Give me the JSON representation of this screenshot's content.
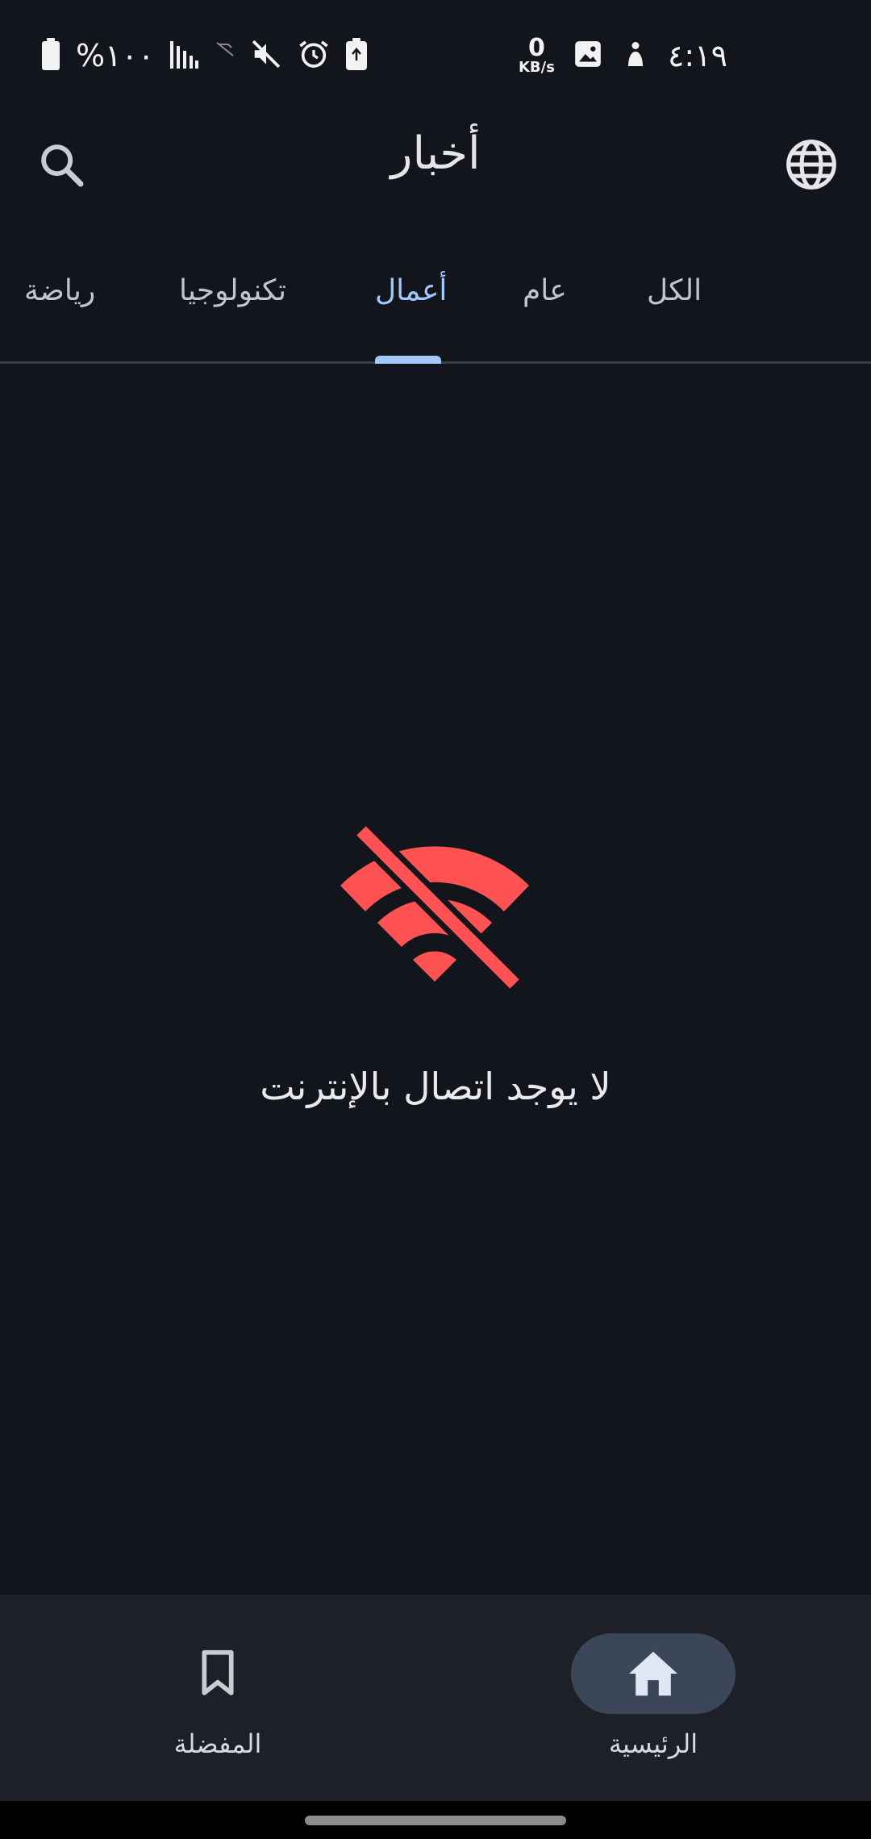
{
  "status_bar": {
    "time": "٤:١٩",
    "net_speed_value": "0",
    "net_speed_unit": "KB/s",
    "battery_text": "%١٠٠",
    "icons": [
      "person-icon",
      "image-icon",
      "battery-saver-icon",
      "alarm-icon",
      "mute-icon",
      "no-sim-icon",
      "signal-icon",
      "battery-icon"
    ]
  },
  "app_bar": {
    "title": "أخبار",
    "search_icon": "search-icon",
    "globe_icon": "globe-icon"
  },
  "tabs": [
    {
      "label": "الكل",
      "active": false
    },
    {
      "label": "عام",
      "active": false
    },
    {
      "label": "أعمال",
      "active": true
    },
    {
      "label": "تكنولوجيا",
      "active": false
    },
    {
      "label": "رياضة",
      "active": false
    }
  ],
  "empty_state": {
    "icon": "wifi-off-icon",
    "message": "لا يوجد اتصال بالإنترنت",
    "icon_color": "#ff5252"
  },
  "bottom_nav": {
    "items": [
      {
        "label": "الرئيسية",
        "icon": "home-icon",
        "selected": true
      },
      {
        "label": "المفضلة",
        "icon": "bookmark-icon",
        "selected": false
      }
    ]
  },
  "colors": {
    "background": "#12151b",
    "accent": "#a3c8ff",
    "nav_background": "#1d2027",
    "nav_selected_pill": "#3b4658"
  }
}
